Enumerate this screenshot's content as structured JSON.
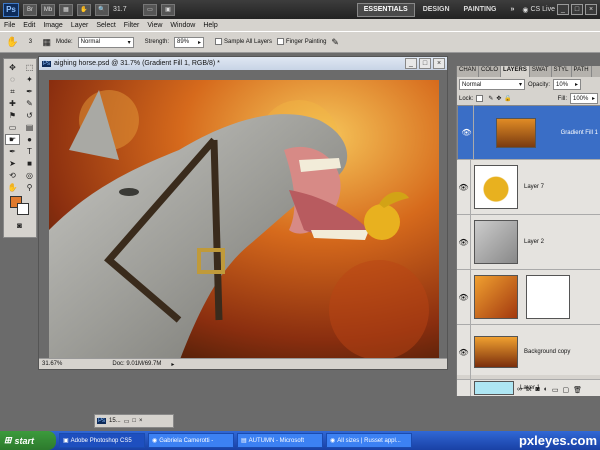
{
  "appbar": {
    "logo": "Ps",
    "zoom": "31.7",
    "workspaces": [
      "ESSENTIALS",
      "DESIGN",
      "PAINTING"
    ],
    "more": "»",
    "cslive": "CS Live",
    "brand_colors": {
      "bg": "#2b2b2b",
      "accent": "#3e79c7"
    }
  },
  "menu": [
    "File",
    "Edit",
    "Image",
    "Layer",
    "Select",
    "Filter",
    "View",
    "Window",
    "Help"
  ],
  "options": {
    "mode_label": "Mode:",
    "mode_value": "Normal",
    "strength_label": "Strength:",
    "strength_value": "89%",
    "sample_all": "Sample All Layers",
    "finger_painting": "Finger Painting",
    "brush_size": "3"
  },
  "document": {
    "title": "aighing horse.psd @ 31.7% (Gradient Fill 1, RGB/8) *",
    "zoom_status": "31.67%",
    "doc_size": "Doc: 9.01M/69.7M"
  },
  "layers_panel": {
    "tabs": [
      "CHAN",
      "COLO",
      "LAYERS",
      "SWAT",
      "STYL",
      "PATH"
    ],
    "blend_mode": "Normal",
    "opacity_label": "Opacity:",
    "opacity": "10%",
    "lock_label": "Lock:",
    "fill_label": "Fill:",
    "fill": "100%",
    "layers": [
      {
        "name": "Gradient Fill 1",
        "selected": true
      },
      {
        "name": "Layer 7",
        "selected": false
      },
      {
        "name": "Layer 2",
        "selected": false
      },
      {
        "name": "",
        "selected": false
      },
      {
        "name": "Background copy",
        "selected": false
      },
      {
        "name": "Layer 1",
        "selected": false
      }
    ]
  },
  "mini_doc": {
    "label": "15..."
  },
  "taskbar": {
    "start": "start",
    "tasks": [
      "Adobe Photoshop CS5",
      "Gabriela Camerotti -",
      "AUTUMN - Microsoft",
      "All sizes | Russet appl..."
    ],
    "brand": "pxleyes.com"
  }
}
